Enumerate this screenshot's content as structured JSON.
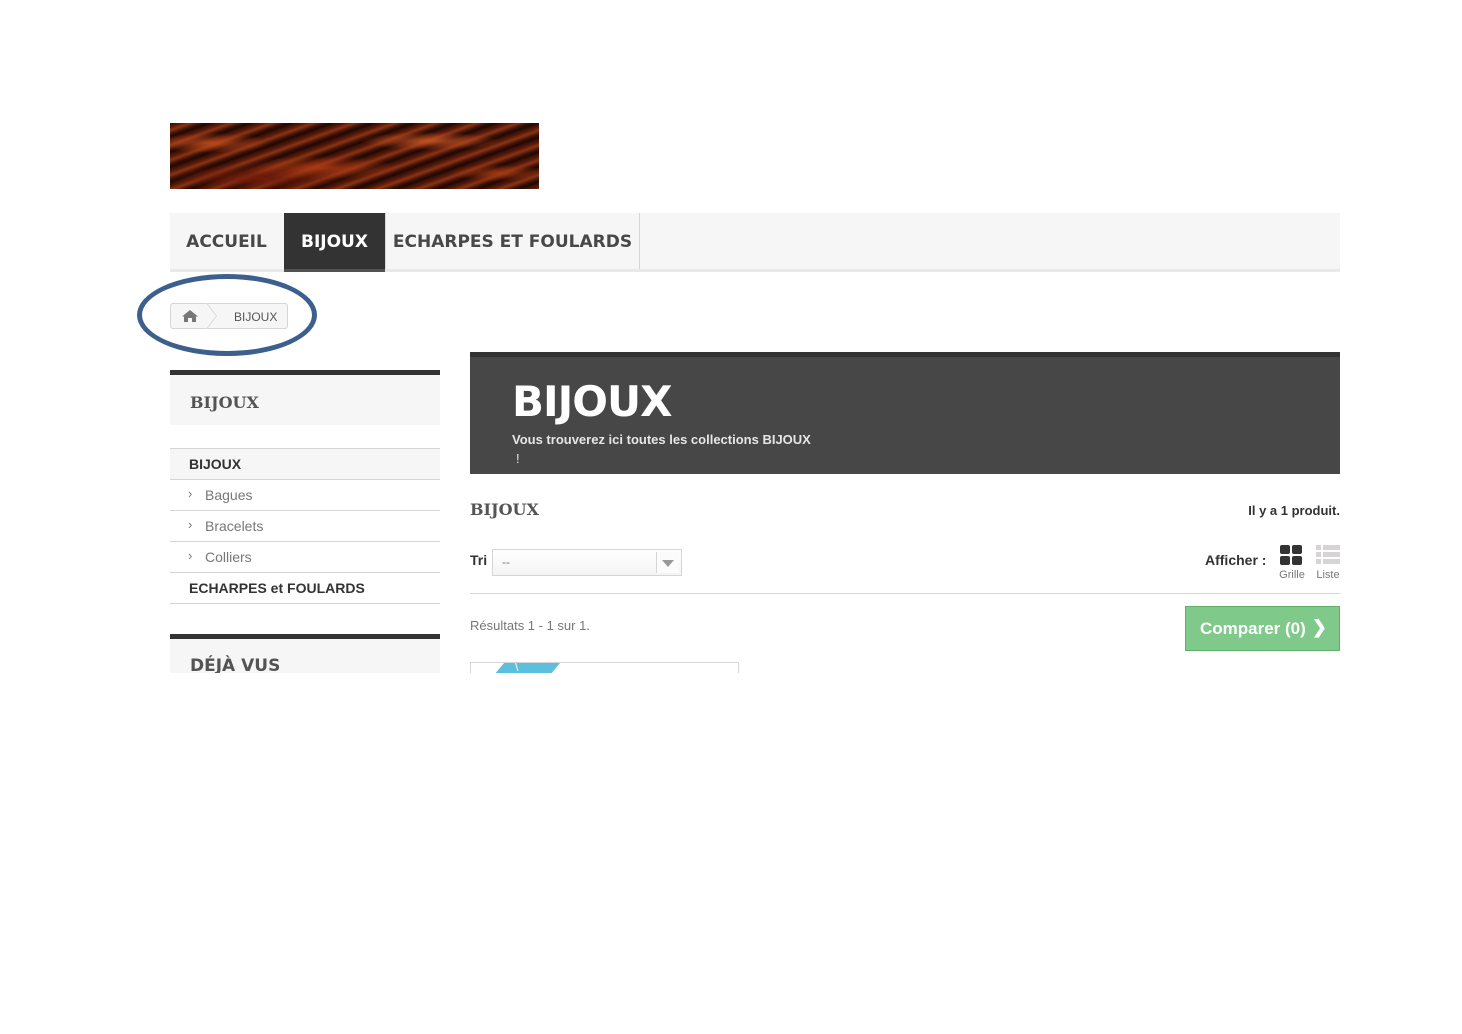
{
  "menu": {
    "items": [
      {
        "label": "ACCUEIL",
        "active": false
      },
      {
        "label": "BIJOUX",
        "active": true
      },
      {
        "label": "ECHARPES ET FOULARDS",
        "active": false
      }
    ]
  },
  "breadcrumb": {
    "home_icon": "home-icon",
    "current": "BIJOUX"
  },
  "sidebar": {
    "categories_title": "BIJOUX",
    "categories": [
      {
        "label": "BIJOUX",
        "level": 0
      },
      {
        "label": "Bagues",
        "level": 1
      },
      {
        "label": "Bracelets",
        "level": 1
      },
      {
        "label": "Colliers",
        "level": 1
      },
      {
        "label": "ECHARPES et FOULARDS",
        "level": 0
      }
    ],
    "viewed_title": "DÉJÀ VUS"
  },
  "hero": {
    "title": "BIJOUX",
    "description": "Vous trouverez ici toutes les collections BIJOUX",
    "extra": "!"
  },
  "listing": {
    "category_title": "BIJOUX",
    "count": "Il y a 1 produit.",
    "sort_label": "Tri",
    "sort_value": "--",
    "view_label": "Afficher :",
    "view_grid": "Grille",
    "view_list": "Liste",
    "results": "Résultats 1 - 1 sur 1.",
    "compare": "Comparer (0)"
  },
  "colors": {
    "accent_dark": "#333333",
    "hero_bg": "#474747",
    "compare_green": "#7fc98a",
    "annotation_blue": "#3c5f8e"
  }
}
